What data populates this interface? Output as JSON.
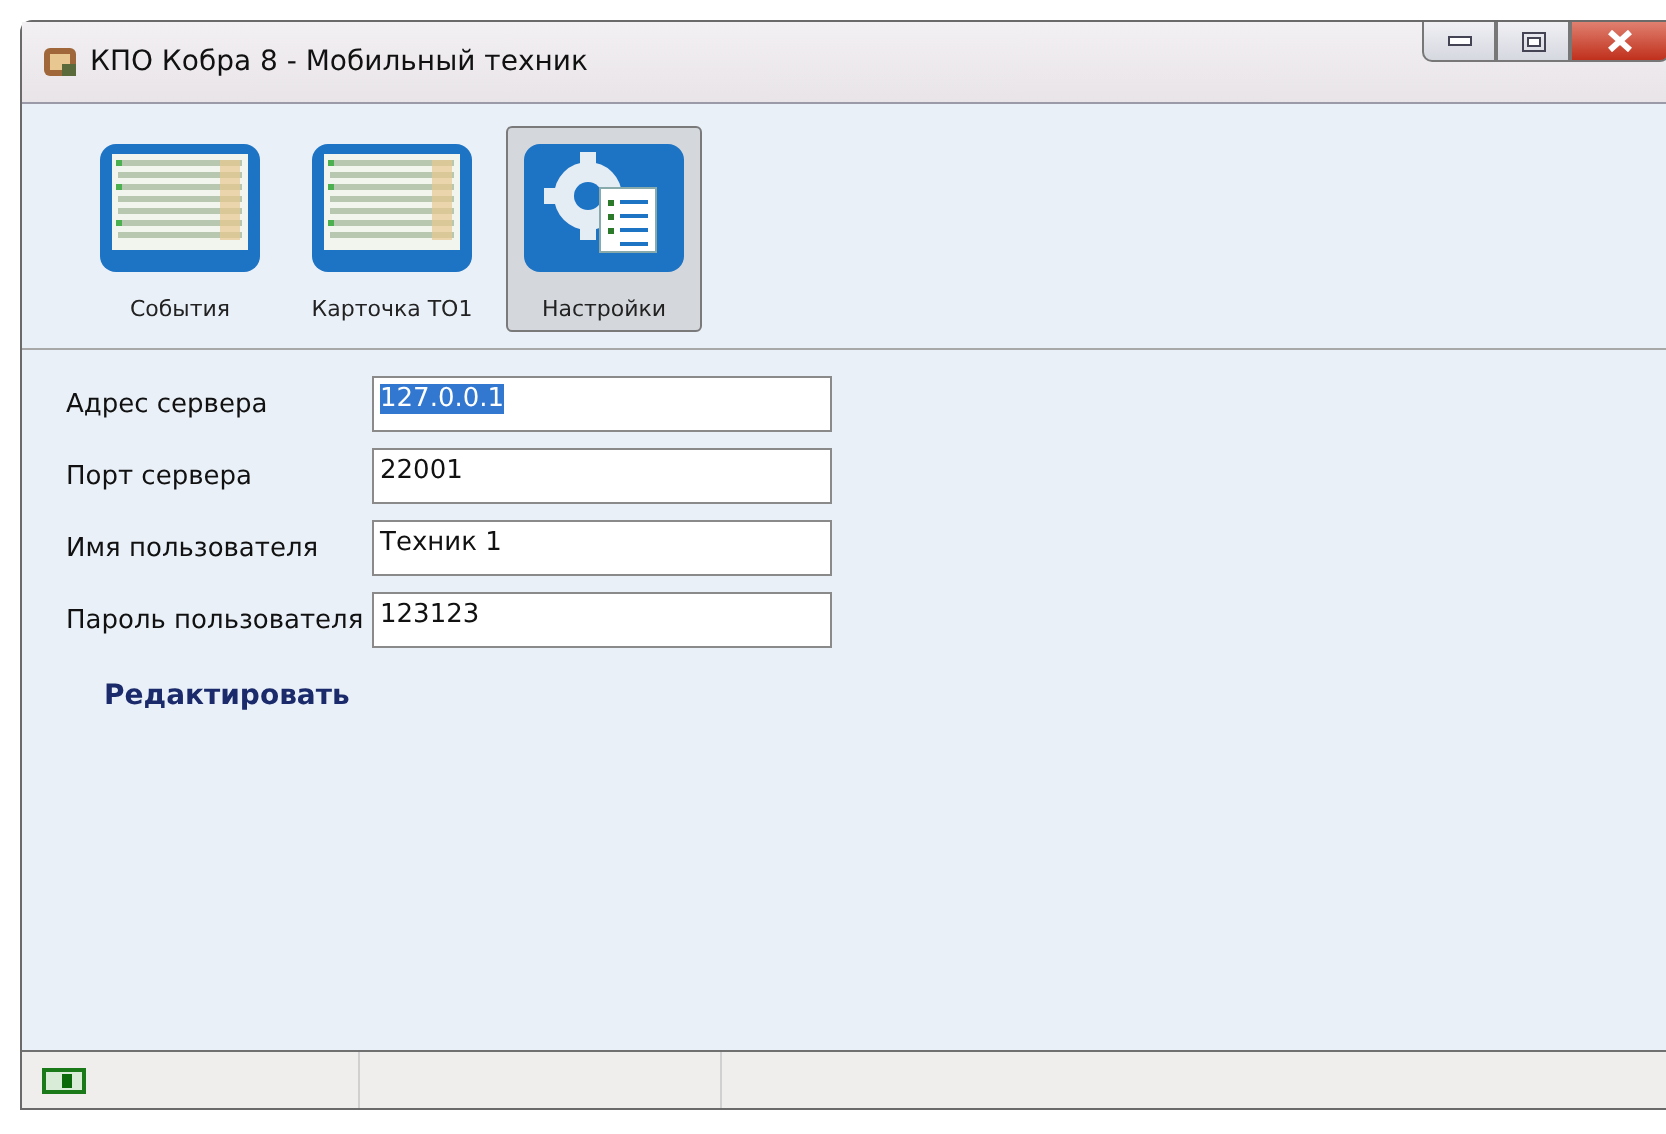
{
  "window": {
    "title": "КПО Кобра 8 - Мобильный техник"
  },
  "toolbar": [
    {
      "label": "События",
      "kind": "table",
      "selected": false
    },
    {
      "label": "Карточка ТО1",
      "kind": "table",
      "selected": false
    },
    {
      "label": "Настройки",
      "kind": "settings",
      "selected": true
    }
  ],
  "fields": [
    {
      "label": "Адрес сервера",
      "value": "127.0.0.1",
      "text_selected": true
    },
    {
      "label": "Порт сервера",
      "value": "22001",
      "text_selected": false
    },
    {
      "label": "Имя пользователя",
      "value": "Техник 1",
      "text_selected": false
    },
    {
      "label": "Пароль пользователя",
      "value": "123123",
      "text_selected": false
    }
  ],
  "edit_link": "Редактировать"
}
